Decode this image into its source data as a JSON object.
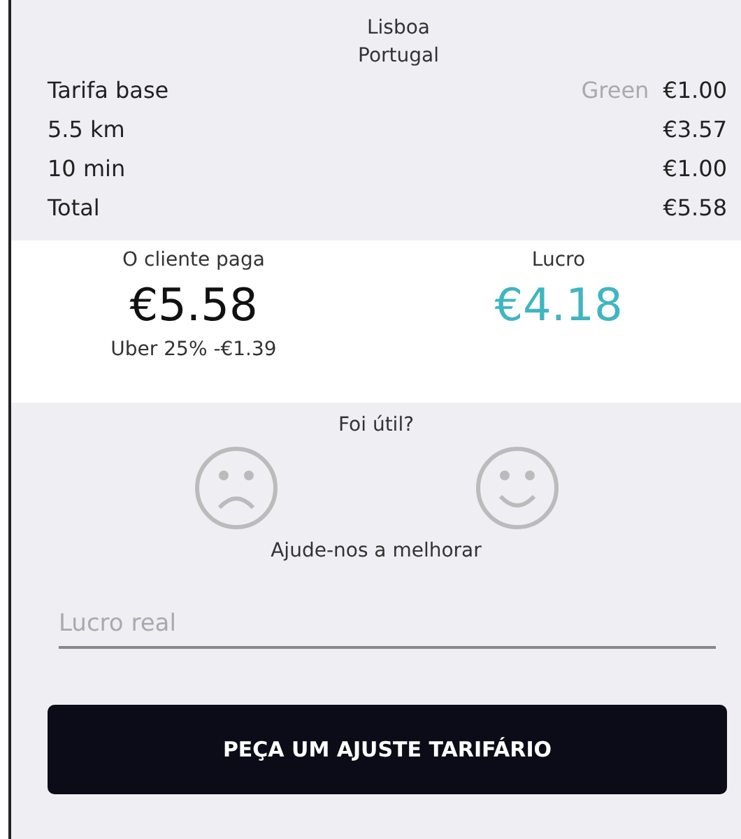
{
  "location": {
    "city": "Lisboa",
    "country": "Portugal"
  },
  "fare_rows": [
    {
      "label": "Tarifa base",
      "tag": "Green",
      "amount": "€1.00"
    },
    {
      "label": "5.5 km",
      "amount": "€3.57"
    },
    {
      "label": "10 min",
      "amount": "€1.00"
    },
    {
      "label": "Total",
      "amount": "€5.58"
    }
  ],
  "summary": {
    "client_label": "O cliente paga",
    "client_amount": "€5.58",
    "commission": "Uber 25% -€1.39",
    "profit_label": "Lucro",
    "profit_amount": "€4.18"
  },
  "feedback": {
    "question": "Foi útil?",
    "help": "Ajude-nos a melhorar"
  },
  "real_profit_field": {
    "placeholder": "Lucro real"
  },
  "button": "PEÇA UM AJUSTE TARIFÁRIO"
}
